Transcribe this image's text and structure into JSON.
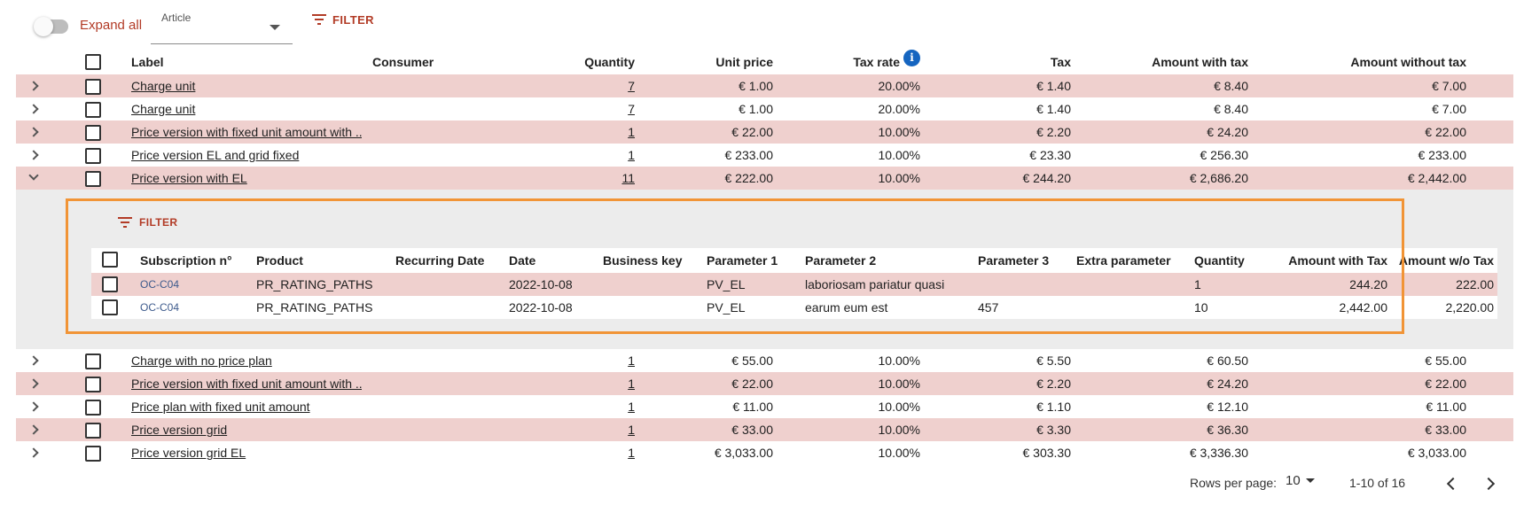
{
  "toolbar": {
    "expand_all_label": "Expand all",
    "expand_all_on": false,
    "group_select_label": "Article",
    "group_select_value": "",
    "filter_label": "FILTER"
  },
  "columns": {
    "label": "Label",
    "consumer": "Consumer",
    "quantity": "Quantity",
    "unit_price": "Unit price",
    "tax_rate": "Tax rate",
    "tax": "Tax",
    "amount_with_tax": "Amount with tax",
    "amount_without_tax": "Amount without tax",
    "info_glyph": "i"
  },
  "rows_before": [
    {
      "label": "Charge unit",
      "consumer": "",
      "quantity": "7",
      "unit_price": "€ 1.00",
      "tax_rate": "20.00%",
      "tax": "€ 1.40",
      "amount_with_tax": "€ 8.40",
      "amount_without_tax": "€ 7.00"
    },
    {
      "label": "Charge unit",
      "consumer": "",
      "quantity": "7",
      "unit_price": "€ 1.00",
      "tax_rate": "20.00%",
      "tax": "€ 1.40",
      "amount_with_tax": "€ 8.40",
      "amount_without_tax": "€ 7.00"
    },
    {
      "label": "Price version with fixed unit amount with ...",
      "consumer": "",
      "quantity": "1",
      "unit_price": "€ 22.00",
      "tax_rate": "10.00%",
      "tax": "€ 2.20",
      "amount_with_tax": "€ 24.20",
      "amount_without_tax": "€ 22.00"
    },
    {
      "label": "Price version EL and grid fixed",
      "consumer": "",
      "quantity": "1",
      "unit_price": "€ 233.00",
      "tax_rate": "10.00%",
      "tax": "€ 23.30",
      "amount_with_tax": "€ 256.30",
      "amount_without_tax": "€ 233.00"
    }
  ],
  "expanded_row": {
    "label": "Price version with EL",
    "consumer": "",
    "quantity": "11",
    "unit_price": "€ 222.00",
    "tax_rate": "10.00%",
    "tax": "€ 244.20",
    "amount_with_tax": "€ 2,686.20",
    "amount_without_tax": "€ 2,442.00"
  },
  "detail": {
    "filter_label": "FILTER",
    "columns": {
      "subscription": "Subscription n°",
      "product": "Product",
      "recurring_date": "Recurring Date",
      "date": "Date",
      "business_key": "Business key",
      "param1": "Parameter 1",
      "param2": "Parameter 2",
      "param3": "Parameter 3",
      "extra": "Extra parameter",
      "quantity": "Quantity",
      "amount_with_tax": "Amount with Tax",
      "amount_wo_tax": "Amount w/o Tax"
    },
    "rows": [
      {
        "subscription": "OC-C04",
        "product": "PR_RATING_PATHS",
        "recurring_date": "",
        "date": "2022-10-08",
        "business_key": "",
        "param1": "PV_EL",
        "param2": "laboriosam pariatur quasi",
        "param3": "",
        "extra": "",
        "quantity": "1",
        "amount_with_tax": "244.20",
        "amount_wo_tax": "222.00"
      },
      {
        "subscription": "OC-C04",
        "product": "PR_RATING_PATHS",
        "recurring_date": "",
        "date": "2022-10-08",
        "business_key": "",
        "param1": "PV_EL",
        "param2": "earum eum est",
        "param3": "457",
        "extra": "",
        "quantity": "10",
        "amount_with_tax": "2,442.00",
        "amount_wo_tax": "2,220.00"
      }
    ]
  },
  "rows_after": [
    {
      "label": "Charge with no price plan",
      "consumer": "",
      "quantity": "1",
      "unit_price": "€ 55.00",
      "tax_rate": "10.00%",
      "tax": "€ 5.50",
      "amount_with_tax": "€ 60.50",
      "amount_without_tax": "€ 55.00"
    },
    {
      "label": "Price version with fixed unit amount with ...",
      "consumer": "",
      "quantity": "1",
      "unit_price": "€ 22.00",
      "tax_rate": "10.00%",
      "tax": "€ 2.20",
      "amount_with_tax": "€ 24.20",
      "amount_without_tax": "€ 22.00"
    },
    {
      "label": "Price plan with fixed unit amount",
      "consumer": "",
      "quantity": "1",
      "unit_price": "€ 11.00",
      "tax_rate": "10.00%",
      "tax": "€ 1.10",
      "amount_with_tax": "€ 12.10",
      "amount_without_tax": "€ 11.00"
    },
    {
      "label": "Price version grid",
      "consumer": "",
      "quantity": "1",
      "unit_price": "€ 33.00",
      "tax_rate": "10.00%",
      "tax": "€ 3.30",
      "amount_with_tax": "€ 36.30",
      "amount_without_tax": "€ 33.00"
    },
    {
      "label": "Price version grid EL",
      "consumer": "",
      "quantity": "1",
      "unit_price": "€ 3,033.00",
      "tax_rate": "10.00%",
      "tax": "€ 303.30",
      "amount_with_tax": "€ 3,336.30",
      "amount_without_tax": "€ 3,033.00"
    }
  ],
  "footer": {
    "rows_per_page_label": "Rows per page:",
    "rows_per_page_value": "10",
    "range": "1-10 of 16"
  },
  "colors": {
    "accent": "#b23b26",
    "row_highlight": "#efd0ce",
    "detail_bg": "#ececec",
    "focus_border": "#f19436",
    "info": "#1565c0"
  }
}
